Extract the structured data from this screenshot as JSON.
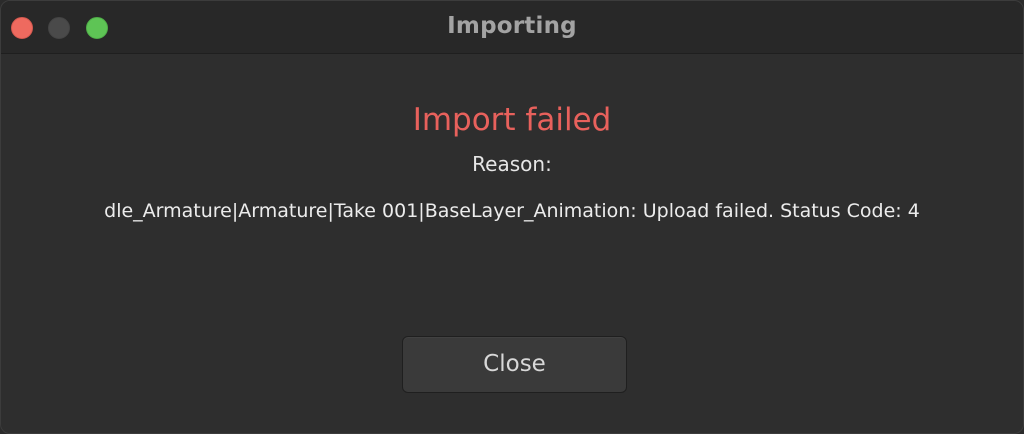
{
  "window": {
    "title": "Importing",
    "controls": [
      "close",
      "minimize",
      "zoom"
    ]
  },
  "dialog": {
    "headline": "Import failed",
    "reason_label": "Reason:",
    "reason_text": "dle_Armature|Armature|Take 001|BaseLayer_Animation: Upload failed. Status Code: 4",
    "close_label": "Close"
  },
  "colors": {
    "error": "#e8615c",
    "traffic_close": "#ee6a5f",
    "traffic_minimize": "#4a4a4a",
    "traffic_zoom": "#5ec455"
  }
}
